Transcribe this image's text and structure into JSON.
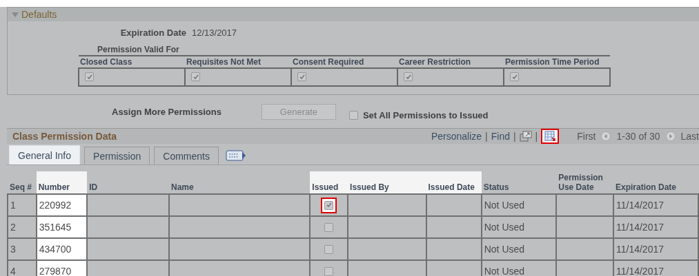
{
  "defaults": {
    "title": "Defaults",
    "expanded": true,
    "expiration_label": "Expiration Date",
    "expiration_date": "12/13/2017",
    "valid_for_label": "Permission Valid For",
    "valid_for": [
      {
        "label": "Closed Class",
        "checked": true
      },
      {
        "label": "Requisites Not Met",
        "checked": true
      },
      {
        "label": "Consent Required",
        "checked": true
      },
      {
        "label": "Career Restriction",
        "checked": true
      },
      {
        "label": "Permission Time Period",
        "checked": true
      }
    ]
  },
  "assign": {
    "label": "Assign More Permissions",
    "button": {
      "label": "Generate",
      "disabled": true
    },
    "set_all": {
      "label": "Set All Permissions to Issued",
      "checked": false
    }
  },
  "grid": {
    "title": "Class Permission Data",
    "toolbar": [
      {
        "kind": "link",
        "label": "Personalize"
      },
      {
        "kind": "separator",
        "label": "|"
      },
      {
        "kind": "link",
        "label": "Find"
      },
      {
        "kind": "separator",
        "label": "|"
      },
      {
        "kind": "new_window"
      },
      {
        "kind": "separator",
        "label": "|"
      },
      {
        "kind": "download",
        "outlined": true
      }
    ],
    "first": "First",
    "range": "1-30 of 30",
    "last": "Last",
    "tabs": [
      {
        "label": "General Info",
        "selected": true
      },
      {
        "label": "Permission",
        "selected": false
      },
      {
        "label": "Comments",
        "selected": false
      }
    ],
    "columns": [
      {
        "label": "Seq #",
        "highlighted": false
      },
      {
        "label": "Number",
        "highlighted": true
      },
      {
        "label": "ID",
        "highlighted": false
      },
      {
        "label": "Name",
        "highlighted": false
      },
      {
        "label": "Issued",
        "highlighted": true
      },
      {
        "label": "Issued By",
        "highlighted": true
      },
      {
        "label": "Issued Date",
        "highlighted": true
      },
      {
        "label": "Status",
        "highlighted": false
      },
      {
        "label": "Permission Use Date",
        "highlighted": false
      },
      {
        "label": "Expiration Date",
        "highlighted": false
      }
    ],
    "rows": [
      {
        "seq": "1",
        "number": "220992",
        "issued": true,
        "issued_outlined": true,
        "status": "Not Used",
        "expiration": "11/14/2017"
      },
      {
        "seq": "2",
        "number": "351645",
        "issued": false,
        "issued_outlined": false,
        "status": "Not Used",
        "expiration": "11/14/2017"
      },
      {
        "seq": "3",
        "number": "434700",
        "issued": false,
        "issued_outlined": false,
        "status": "Not Used",
        "expiration": "11/14/2017"
      },
      {
        "seq": "4",
        "number": "279870",
        "issued": false,
        "issued_outlined": false,
        "status": "Not Used",
        "expiration": "11/14/2017"
      }
    ]
  }
}
